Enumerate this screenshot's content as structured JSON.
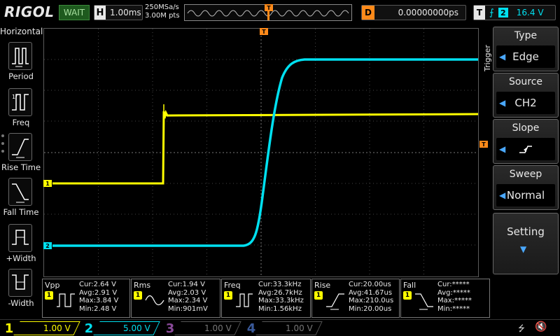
{
  "topbar": {
    "brand": "RIGOL",
    "run_status": "WAIT",
    "horizontal": {
      "letter": "H",
      "timebase": "1.00ms"
    },
    "sample_rate": "250MSa/s",
    "memory_depth": "3.00M pts",
    "trig_pos_letter": "T",
    "delay": {
      "letter": "D",
      "value": "0.00000000ps"
    },
    "trigger": {
      "letter": "T",
      "source_num": "2",
      "level": "16.4 V",
      "edge_symbol": "⨍"
    }
  },
  "left_menu": {
    "title": "Horizontal",
    "items": [
      {
        "label": "Period",
        "icon": "period-icon"
      },
      {
        "label": "Freq",
        "icon": "freq-icon"
      },
      {
        "label": "Rise Time",
        "icon": "rise-time-icon"
      },
      {
        "label": "Fall Time",
        "icon": "fall-time-icon"
      },
      {
        "label": "+Width",
        "icon": "positive-width-icon"
      },
      {
        "label": "-Width",
        "icon": "negative-width-icon"
      }
    ]
  },
  "channels": {
    "ch1": {
      "label": "1",
      "color": "#ffff00"
    },
    "ch2": {
      "label": "2",
      "color": "#00e0f0"
    },
    "trigger_level_marker": "T"
  },
  "trigger_panel": {
    "tab_label": "Trigger",
    "type": {
      "title": "Type",
      "value": "Edge"
    },
    "source": {
      "title": "Source",
      "value": "CH2"
    },
    "slope": {
      "title": "Slope",
      "icon": "rising-edge-icon"
    },
    "sweep": {
      "title": "Sweep",
      "value": "Normal"
    },
    "setting": {
      "title": "Setting"
    }
  },
  "measurements": [
    {
      "name": "Vpp",
      "ch": "1",
      "cur": "Cur:2.64 V",
      "avg": "Avg:2.91 V",
      "max": "Max:3.84 V",
      "min": "Min:2.48 V"
    },
    {
      "name": "Rms",
      "ch": "1",
      "cur": "Cur:1.94 V",
      "avg": "Avg:2.03 V",
      "max": "Max:2.34 V",
      "min": "Min:901mV"
    },
    {
      "name": "Freq",
      "ch": "1",
      "cur": "Cur:33.3kHz",
      "avg": "Avg:26.7kHz",
      "max": "Max:33.3kHz",
      "min": "Min:1.56kHz"
    },
    {
      "name": "Rise",
      "ch": "1",
      "cur": "Cur:20.00us",
      "avg": "Avg:41.67us",
      "max": "Max:210.0us",
      "min": "Min:20.00us"
    },
    {
      "name": "Fall",
      "ch": "1",
      "cur": "Cur:*****",
      "avg": "Avg:*****",
      "max": "Max:*****",
      "min": "Min:*****"
    }
  ],
  "bottom_channels": [
    {
      "num": "1",
      "scale": "1.00 V",
      "color": "#ffff00",
      "active": true
    },
    {
      "num": "2",
      "scale": "5.00 V",
      "color": "#00e0f0",
      "active": true
    },
    {
      "num": "3",
      "scale": "1.00 V",
      "color": "#8a4a9a",
      "active": false
    },
    {
      "num": "4",
      "scale": "1.00 V",
      "color": "#3a5a9a",
      "active": false
    }
  ],
  "icons": {
    "usb": "usb-icon",
    "speaker": "speaker-muted-icon"
  }
}
